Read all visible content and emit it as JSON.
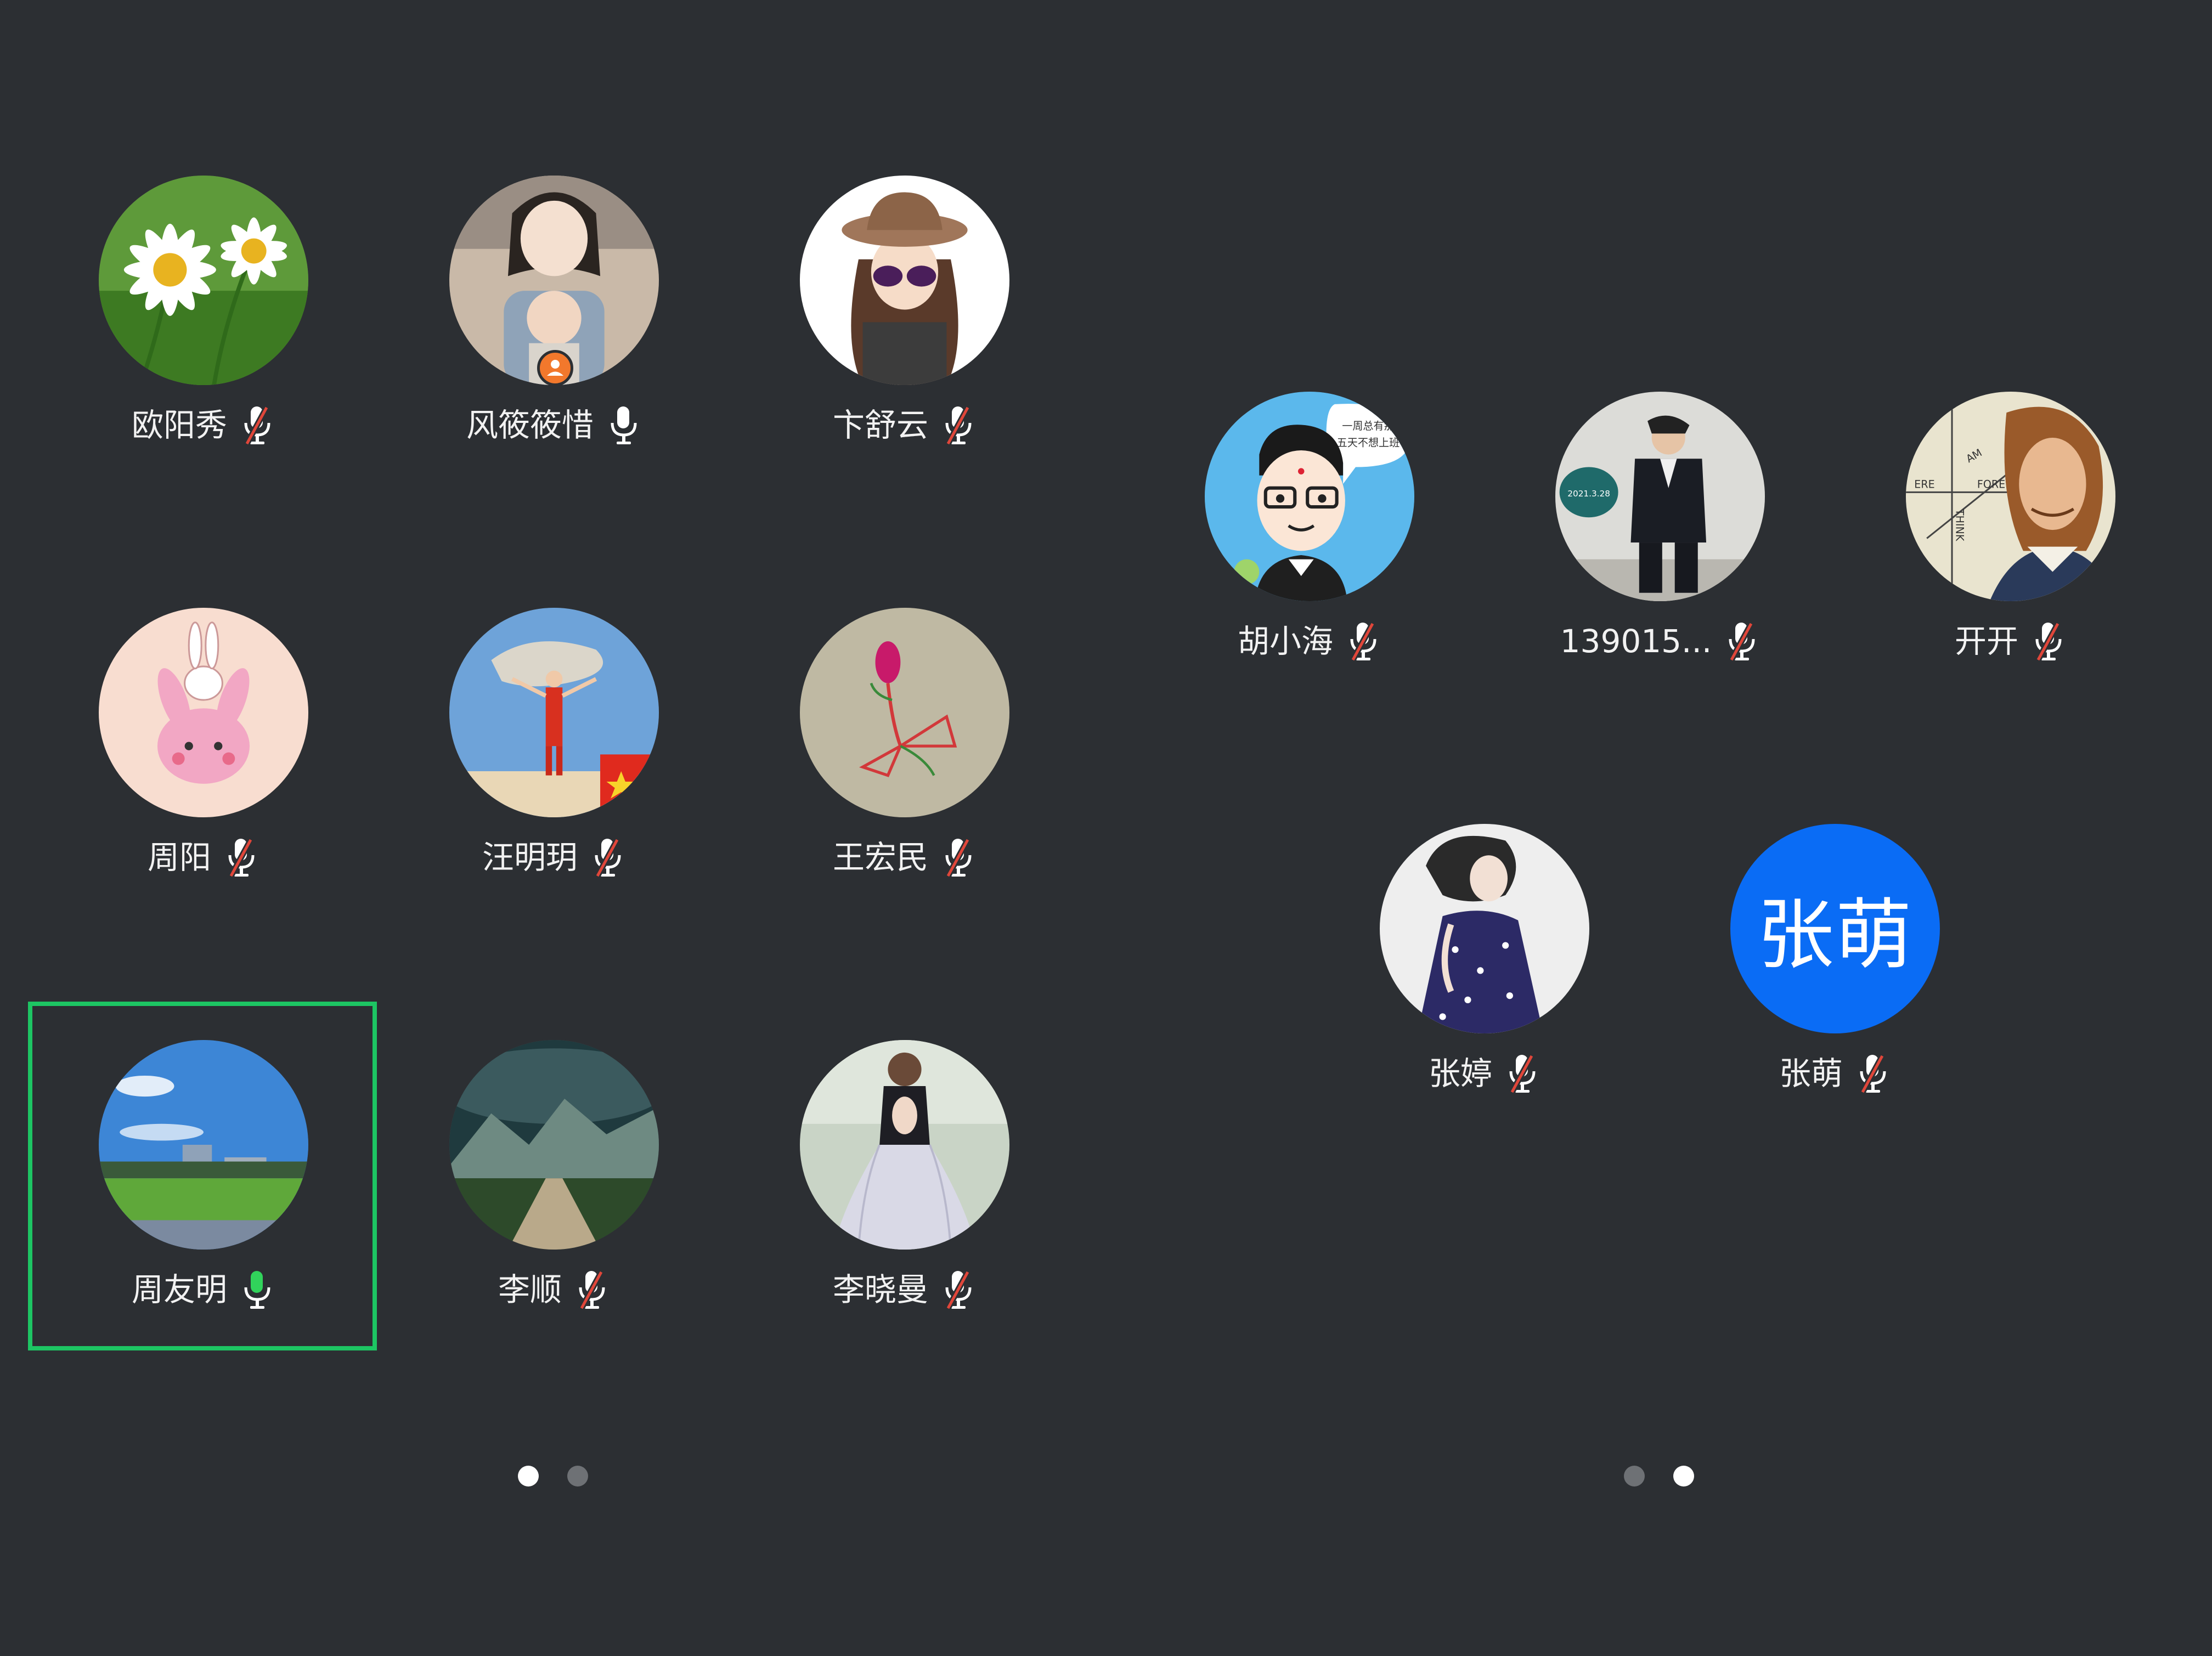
{
  "colors": {
    "background": "#2c2f33",
    "speaking_frame": "#1dc563",
    "mic_muted_slash": "#e0463a",
    "mic_active": "#31d35b",
    "host_badge": "#f2782c",
    "letter_avatar": "#0a6cf5",
    "dot_active": "#ffffff",
    "dot_inactive": "#6e7175"
  },
  "page_left": {
    "participants": [
      {
        "name": "欧阳秀",
        "mic": "muted",
        "avatar_icon": "daisy-photo-avatar"
      },
      {
        "name": "风筱筱惜",
        "mic": "on",
        "avatar_icon": "mother-baby-cartoon-avatar",
        "host_badge_icon": "host-person-icon"
      },
      {
        "name": "卞舒云",
        "mic": "muted",
        "avatar_icon": "girl-sunglasses-cartoon-avatar"
      },
      {
        "name": "周阳",
        "mic": "muted",
        "avatar_icon": "pink-bunny-cartoon-avatar"
      },
      {
        "name": "汪明玥",
        "mic": "muted",
        "avatar_icon": "desert-pose-photo-avatar"
      },
      {
        "name": "王宏民",
        "mic": "muted",
        "avatar_icon": "flower-drawing-avatar"
      },
      {
        "name": "周友明",
        "mic": "speaking",
        "avatar_icon": "campus-sky-photo-avatar",
        "highlighted": true
      },
      {
        "name": "李顺",
        "mic": "muted",
        "avatar_icon": "storm-mountain-road-avatar"
      },
      {
        "name": "李晓曼",
        "mic": "muted",
        "avatar_icon": "lace-dress-photo-avatar"
      }
    ],
    "pager": {
      "current": 1,
      "total": 2
    }
  },
  "page_right": {
    "participants": [
      {
        "name": "胡小海",
        "mic": "muted",
        "avatar_icon": "glasses-boy-cartoon-avatar",
        "bubble_lines": [
          "一周总有那",
          "五天不想上班"
        ]
      },
      {
        "name": "139015...",
        "mic": "muted",
        "avatar_icon": "man-in-suit-photo-avatar",
        "badge_text": "2021.3.28"
      },
      {
        "name": "开开",
        "mic": "muted",
        "avatar_icon": "descartes-portrait-avatar",
        "portrait_words": [
          "ERE",
          "AM",
          "FORE",
          "THINK"
        ]
      },
      {
        "name": "张婷",
        "mic": "muted",
        "avatar_icon": "girl-polka-dress-avatar"
      },
      {
        "name": "张萌",
        "mic": "muted",
        "avatar_letters": "张萌"
      }
    ],
    "pager": {
      "current": 2,
      "total": 2
    }
  }
}
